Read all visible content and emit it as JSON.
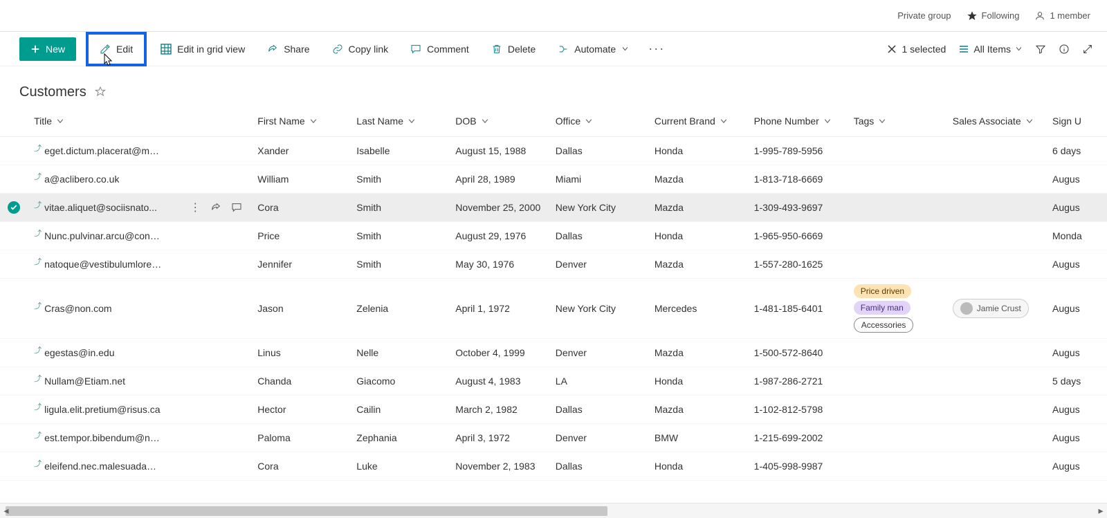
{
  "top_strip": {
    "group_type": "Private group",
    "following": "Following",
    "members": "1 member"
  },
  "cmdbar": {
    "new_label": "New",
    "edit": "Edit",
    "edit_grid": "Edit in grid view",
    "share": "Share",
    "copy_link": "Copy link",
    "comment": "Comment",
    "delete": "Delete",
    "automate": "Automate",
    "selected_text": "1 selected",
    "view_label": "All Items"
  },
  "list_title": "Customers",
  "columns": {
    "title": "Title",
    "fn": "First Name",
    "ln": "Last Name",
    "dob": "DOB",
    "office": "Office",
    "brand": "Current Brand",
    "phone": "Phone Number",
    "tags": "Tags",
    "assoc": "Sales Associate",
    "signup": "Sign U"
  },
  "rows": [
    {
      "selected": false,
      "title": "eget.dictum.placerat@mattis.ca",
      "fn": "Xander",
      "ln": "Isabelle",
      "dob": "August 15, 1988",
      "office": "Dallas",
      "brand": "Honda",
      "phone": "1-995-789-5956",
      "tags": [],
      "assoc": "",
      "signup": "6 days"
    },
    {
      "selected": false,
      "title": "a@aclibero.co.uk",
      "fn": "William",
      "ln": "Smith",
      "dob": "April 28, 1989",
      "office": "Miami",
      "brand": "Mazda",
      "phone": "1-813-718-6669",
      "tags": [],
      "assoc": "",
      "signup": "Augus"
    },
    {
      "selected": true,
      "title": "vitae.aliquet@sociisnato...",
      "fn": "Cora",
      "ln": "Smith",
      "dob": "November 25, 2000",
      "office": "New York City",
      "brand": "Mazda",
      "phone": "1-309-493-9697",
      "tags": [],
      "assoc": "",
      "signup": "Augus"
    },
    {
      "selected": false,
      "title": "Nunc.pulvinar.arcu@conubianostraper.edu",
      "fn": "Price",
      "ln": "Smith",
      "dob": "August 29, 1976",
      "office": "Dallas",
      "brand": "Honda",
      "phone": "1-965-950-6669",
      "tags": [],
      "assoc": "",
      "signup": "Monda"
    },
    {
      "selected": false,
      "title": "natoque@vestibulumlorem.edu",
      "fn": "Jennifer",
      "ln": "Smith",
      "dob": "May 30, 1976",
      "office": "Denver",
      "brand": "Mazda",
      "phone": "1-557-280-1625",
      "tags": [],
      "assoc": "",
      "signup": "Augus"
    },
    {
      "selected": false,
      "title": "Cras@non.com",
      "fn": "Jason",
      "ln": "Zelenia",
      "dob": "April 1, 1972",
      "office": "New York City",
      "brand": "Mercedes",
      "phone": "1-481-185-6401",
      "tags": [
        {
          "text": "Price driven",
          "style": "yellow"
        },
        {
          "text": "Family man",
          "style": "purple"
        },
        {
          "text": "Accessories",
          "style": "outline"
        }
      ],
      "assoc": "Jamie Crust",
      "signup": "Augus"
    },
    {
      "selected": false,
      "title": "egestas@in.edu",
      "fn": "Linus",
      "ln": "Nelle",
      "dob": "October 4, 1999",
      "office": "Denver",
      "brand": "Mazda",
      "phone": "1-500-572-8640",
      "tags": [],
      "assoc": "",
      "signup": "Augus"
    },
    {
      "selected": false,
      "title": "Nullam@Etiam.net",
      "fn": "Chanda",
      "ln": "Giacomo",
      "dob": "August 4, 1983",
      "office": "LA",
      "brand": "Honda",
      "phone": "1-987-286-2721",
      "tags": [],
      "assoc": "",
      "signup": "5 days"
    },
    {
      "selected": false,
      "title": "ligula.elit.pretium@risus.ca",
      "fn": "Hector",
      "ln": "Cailin",
      "dob": "March 2, 1982",
      "office": "Dallas",
      "brand": "Mazda",
      "phone": "1-102-812-5798",
      "tags": [],
      "assoc": "",
      "signup": "Augus"
    },
    {
      "selected": false,
      "title": "est.tempor.bibendum@neccursusa.com",
      "fn": "Paloma",
      "ln": "Zephania",
      "dob": "April 3, 1972",
      "office": "Denver",
      "brand": "BMW",
      "phone": "1-215-699-2002",
      "tags": [],
      "assoc": "",
      "signup": "Augus"
    },
    {
      "selected": false,
      "title": "eleifend.nec.malesuada@atrisus.ca",
      "fn": "Cora",
      "ln": "Luke",
      "dob": "November 2, 1983",
      "office": "Dallas",
      "brand": "Honda",
      "phone": "1-405-998-9987",
      "tags": [],
      "assoc": "",
      "signup": "Augus"
    }
  ]
}
